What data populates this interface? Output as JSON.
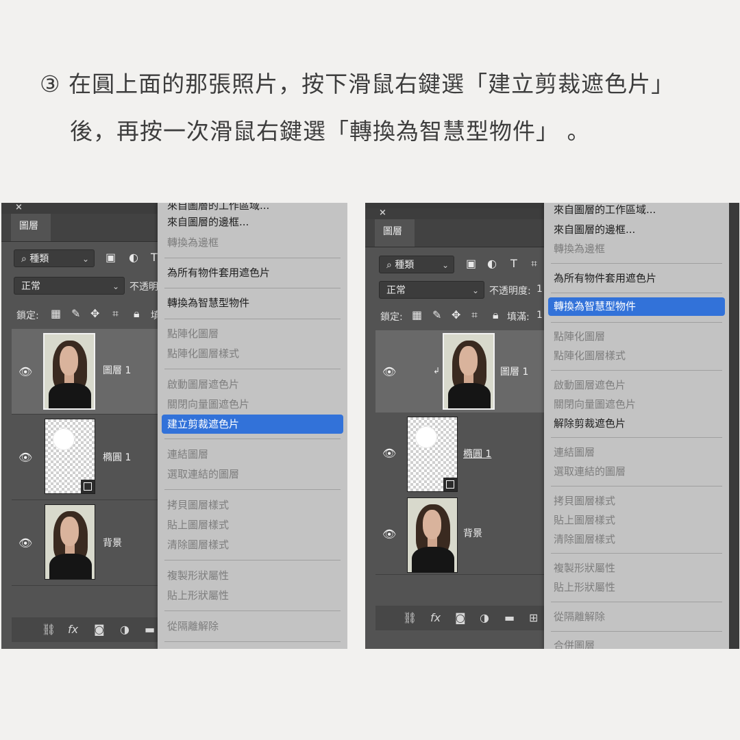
{
  "instruction": {
    "line1": "③ 在圓上面的那張照片，按下滑鼠右鍵選「建立剪裁遮色片」",
    "line2": "後，再按一次滑鼠右鍵選「轉換為智慧型物件」 。"
  },
  "left": {
    "close": "×",
    "tab": "圖層",
    "filter": "種類",
    "blend": "正常",
    "opacity_label": "不透明",
    "lock_label": "鎖定:",
    "fill_label": "填",
    "layers": [
      "圖層 1",
      "橢圓 1",
      "背景"
    ],
    "menu": {
      "top_partial": "來自圖層的工作區域...",
      "items": [
        {
          "label": "來自圖層的邊框...",
          "state": "enabled"
        },
        {
          "label": "轉換為邊框",
          "state": "disabled"
        },
        {
          "label": "為所有物件套用遮色片",
          "state": "enabled"
        },
        {
          "label": "轉換為智慧型物件",
          "state": "enabled"
        },
        {
          "label": "點陣化圖層",
          "state": "disabled"
        },
        {
          "label": "點陣化圖層樣式",
          "state": "disabled"
        },
        {
          "label": "啟動圖層遮色片",
          "state": "disabled"
        },
        {
          "label": "關閉向量圖遮色片",
          "state": "disabled"
        },
        {
          "label": "建立剪裁遮色片",
          "state": "highlighted"
        },
        {
          "label": "連結圖層",
          "state": "disabled"
        },
        {
          "label": "選取連結的圖層",
          "state": "disabled"
        },
        {
          "label": "拷貝圖層樣式",
          "state": "disabled"
        },
        {
          "label": "貼上圖層樣式",
          "state": "disabled"
        },
        {
          "label": "清除圖層樣式",
          "state": "disabled"
        },
        {
          "label": "複製形狀屬性",
          "state": "disabled"
        },
        {
          "label": "貼上形狀屬性",
          "state": "disabled"
        },
        {
          "label": "從隔離解除",
          "state": "disabled"
        }
      ]
    }
  },
  "right": {
    "close": "×",
    "tab": "圖層",
    "filter": "種類",
    "blend": "正常",
    "opacity_label": "不透明度:",
    "opacity_value": "1",
    "lock_label": "鎖定:",
    "fill_label": "填滿:",
    "fill_value": "1",
    "layers": [
      "圖層 1",
      "橢圓 1",
      "背景"
    ],
    "clip_arrow": "↲",
    "menu": {
      "items": [
        {
          "label": "來自圖層的工作區域...",
          "state": "enabled"
        },
        {
          "label": "來自圖層的邊框...",
          "state": "enabled"
        },
        {
          "label": "轉換為邊框",
          "state": "disabled"
        },
        {
          "label": "為所有物件套用遮色片",
          "state": "enabled"
        },
        {
          "label": "轉換為智慧型物件",
          "state": "highlighted"
        },
        {
          "label": "點陣化圖層",
          "state": "disabled"
        },
        {
          "label": "點陣化圖層樣式",
          "state": "disabled"
        },
        {
          "label": "啟動圖層遮色片",
          "state": "disabled"
        },
        {
          "label": "關閉向量圖遮色片",
          "state": "disabled"
        },
        {
          "label": "解除剪裁遮色片",
          "state": "enabled"
        },
        {
          "label": "連結圖層",
          "state": "disabled"
        },
        {
          "label": "選取連結的圖層",
          "state": "disabled"
        },
        {
          "label": "拷貝圖層樣式",
          "state": "disabled"
        },
        {
          "label": "貼上圖層樣式",
          "state": "disabled"
        },
        {
          "label": "清除圖層樣式",
          "state": "disabled"
        },
        {
          "label": "複製形狀屬性",
          "state": "disabled"
        },
        {
          "label": "貼上形狀屬性",
          "state": "disabled"
        },
        {
          "label": "從隔離解除",
          "state": "disabled"
        },
        {
          "label": "合併圖層",
          "state": "disabled"
        }
      ]
    }
  },
  "colors": {
    "highlight": "#3272d9",
    "panel": "#535353",
    "menu": "#c3c3c3"
  }
}
